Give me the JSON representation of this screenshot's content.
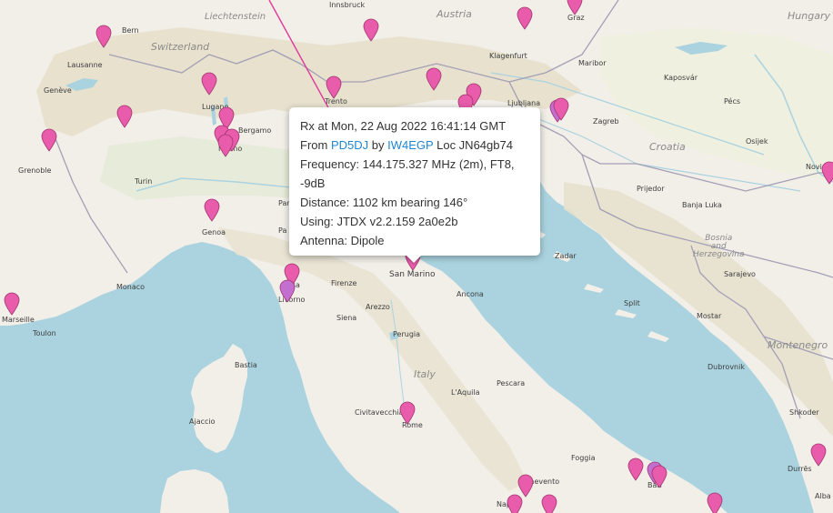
{
  "popup": {
    "rx_line": "Rx at Mon, 22 Aug 2022 16:41:14 GMT",
    "from_prefix": "From",
    "sender_call": "PD5DJ",
    "by_word": "by",
    "receiver_call": "IW4EGP",
    "loc_text": "Loc JN64gb74",
    "frequency_line1": "Frequency: 144.175.327 MHz (2m), FT8,",
    "frequency_line2": "-9dB",
    "distance": "Distance: 1102 km bearing 146°",
    "using": "Using: JTDX v2.2.159 2a0e2b",
    "antenna": "Antenna: Dipole"
  },
  "labels": {
    "liechtenstein": "Liechtenstein",
    "austria": "Austria",
    "hungary": "Hungary",
    "switzerland": "Switzerland",
    "croatia": "Croatia",
    "bosnia": "Bosnia\nand\nHerzegovina",
    "montenegro": "Montenegro",
    "italy": "Italy",
    "innsbruck": "Innsbruck",
    "graz": "Graz",
    "bern": "Bern",
    "lausanne": "Lausanne",
    "geneve": "Genève",
    "klagenfurt": "Klagenfurt",
    "maribor": "Maribor",
    "kaposvar": "Kaposvár",
    "pecs": "Pécs",
    "ljubljana": "Ljubljana",
    "zagreb": "Zagreb",
    "trento": "Trento",
    "lugano": "Lugano",
    "bergamo": "Bergamo",
    "milano": "Milano",
    "grenoble": "Grenoble",
    "torino": "Turin",
    "genova": "Genoa",
    "monaco": "Monaco",
    "marseille": "Marseille",
    "toulon": "Toulon",
    "pisa": "Pisa",
    "livorno": "Livorno",
    "firenze": "Firenze",
    "arezzo": "Arezzo",
    "siena": "Siena",
    "perugia": "Perugia",
    "ancona": "Ancona",
    "sanmarino": "San Marino",
    "zadar": "Zadar",
    "split": "Split",
    "mostar": "Mostar",
    "sarajevo": "Sarajevo",
    "prijedor": "Prijedor",
    "banjaluka": "Banja Luka",
    "osijek": "Osijek",
    "novisad": "Novi Sa",
    "bastia": "Bastia",
    "ajaccio": "Ajaccio",
    "civitavecchia": "Civitavecchia",
    "roma": "Rome",
    "laquila": "L'Aquila",
    "pescara": "Pescara",
    "foggia": "Foggia",
    "benevento": "Benevento",
    "napoli": "Naples",
    "bari": "Bari",
    "dubrovnik": "Dubrovnik",
    "shkoder": "Shkoder",
    "durres": "Durrës",
    "alba": "Alba",
    "parma": "Par",
    "parma2": "Pa"
  },
  "colors": {
    "water": "#aad3df",
    "land": "#f2efe9",
    "mountain": "#e3ddc9",
    "forest": "#d9e6c4",
    "border": "#9e9bb0",
    "marker": "#e85cab",
    "marker_alt": "#c36fd0",
    "path": "#e0389c"
  },
  "markers": [
    {
      "id": "m1",
      "icon": "pin-icon"
    },
    {
      "id": "m2",
      "icon": "pin-icon"
    },
    {
      "id": "m3",
      "icon": "pin-icon"
    },
    {
      "id": "m4",
      "icon": "pin-icon"
    },
    {
      "id": "m5",
      "icon": "pin-icon"
    },
    {
      "id": "m6",
      "icon": "pin-icon"
    },
    {
      "id": "m7",
      "icon": "pin-icon"
    },
    {
      "id": "m8",
      "icon": "pin-icon"
    },
    {
      "id": "m9",
      "icon": "pin-icon"
    },
    {
      "id": "m10",
      "icon": "pin-icon"
    },
    {
      "id": "m11",
      "icon": "pin-icon"
    },
    {
      "id": "m12",
      "icon": "pin-icon"
    },
    {
      "id": "m13",
      "icon": "pin-icon"
    },
    {
      "id": "m14",
      "icon": "pin-icon"
    },
    {
      "id": "m15",
      "icon": "pin-icon"
    },
    {
      "id": "m16",
      "icon": "pin-icon"
    },
    {
      "id": "m17",
      "icon": "pin-icon"
    },
    {
      "id": "m18",
      "icon": "pin-icon"
    },
    {
      "id": "m19",
      "icon": "pin-icon"
    },
    {
      "id": "m20",
      "icon": "pin-icon"
    },
    {
      "id": "m21",
      "icon": "pin-icon"
    },
    {
      "id": "m22",
      "icon": "pin-icon"
    },
    {
      "id": "m23",
      "icon": "pin-icon"
    },
    {
      "id": "m24",
      "icon": "pin-icon"
    },
    {
      "id": "m25",
      "icon": "pin-icon"
    },
    {
      "id": "m26",
      "icon": "pin-icon"
    },
    {
      "id": "m27",
      "icon": "pin-icon"
    },
    {
      "id": "m28",
      "icon": "pin-icon"
    },
    {
      "id": "m29",
      "icon": "pin-icon"
    },
    {
      "id": "m30",
      "icon": "pin-icon"
    }
  ]
}
